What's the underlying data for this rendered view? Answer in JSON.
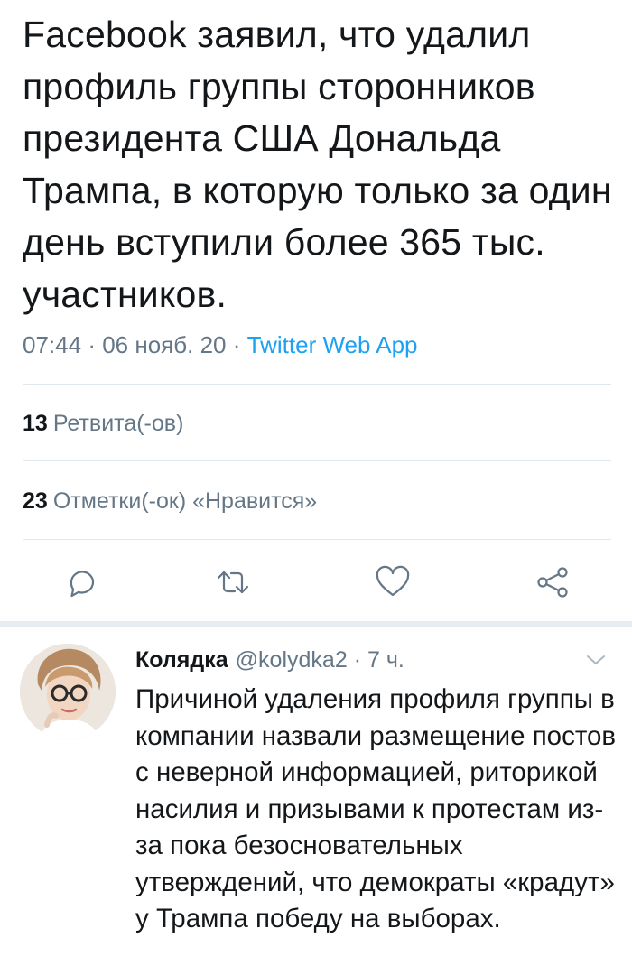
{
  "tweet": {
    "text": "Facebook заявил, что удалил профиль группы сторонников президента США Дональда Трампа, в которую только за один день вступили более 365 тыс. участников.",
    "time": "07:44",
    "separator": "·",
    "date": "06 нояб. 20",
    "source": "Twitter Web App",
    "retweets_count": "13",
    "retweets_label": "Ретвита(-ов)",
    "likes_count": "23",
    "likes_label": "Отметки(-ок) «Нравится»"
  },
  "actions": {
    "reply_icon": "reply-icon",
    "retweet_icon": "retweet-icon",
    "like_icon": "heart-icon",
    "share_icon": "share-icon"
  },
  "reply": {
    "name": "Колядка",
    "handle": "@kolydka2",
    "separator": "·",
    "time": "7 ч.",
    "text": "Причиной удаления профиля группы в компании назвали размещение постов с неверной информацией, риторикой насилия и призывами к протестам из-за пока безосновательных утверждений, что демократы «крадут» у Трампа победу на выборах."
  },
  "colors": {
    "text": "#14171a",
    "secondary": "#657786",
    "link": "#1da1f2",
    "divider": "#e1e8ed"
  }
}
